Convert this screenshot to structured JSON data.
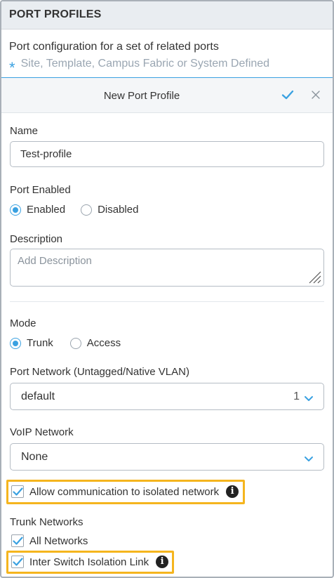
{
  "section": {
    "title": "PORT PROFILES"
  },
  "intro": {
    "description": "Port configuration for a set of related ports",
    "note": "Site, Template, Campus Fabric or System Defined",
    "note_marker": "*"
  },
  "form": {
    "title": "New Port Profile",
    "save_icon": "check-icon",
    "close_icon": "close-icon",
    "name": {
      "label": "Name",
      "value": "Test-profile"
    },
    "port_enabled": {
      "label": "Port Enabled",
      "options": [
        "Enabled",
        "Disabled"
      ],
      "selected": "Enabled"
    },
    "description": {
      "label": "Description",
      "placeholder": "Add Description"
    },
    "mode": {
      "label": "Mode",
      "options": [
        "Trunk",
        "Access"
      ],
      "selected": "Trunk"
    },
    "port_network": {
      "label": "Port Network (Untagged/Native VLAN)",
      "value": "default",
      "count": "1"
    },
    "voip_network": {
      "label": "VoIP Network",
      "value": "None"
    },
    "allow_isolated": {
      "label": "Allow communication to isolated network",
      "checked": true
    },
    "trunk_networks": {
      "label": "Trunk Networks",
      "all_networks": "All Networks",
      "all_checked": true
    },
    "inter_switch": {
      "label": "Inter Switch Isolation Link",
      "checked": true
    }
  },
  "colors": {
    "accent": "#3aa1e1",
    "highlight": "#f5b51e",
    "header_bg": "#e9edf1"
  }
}
